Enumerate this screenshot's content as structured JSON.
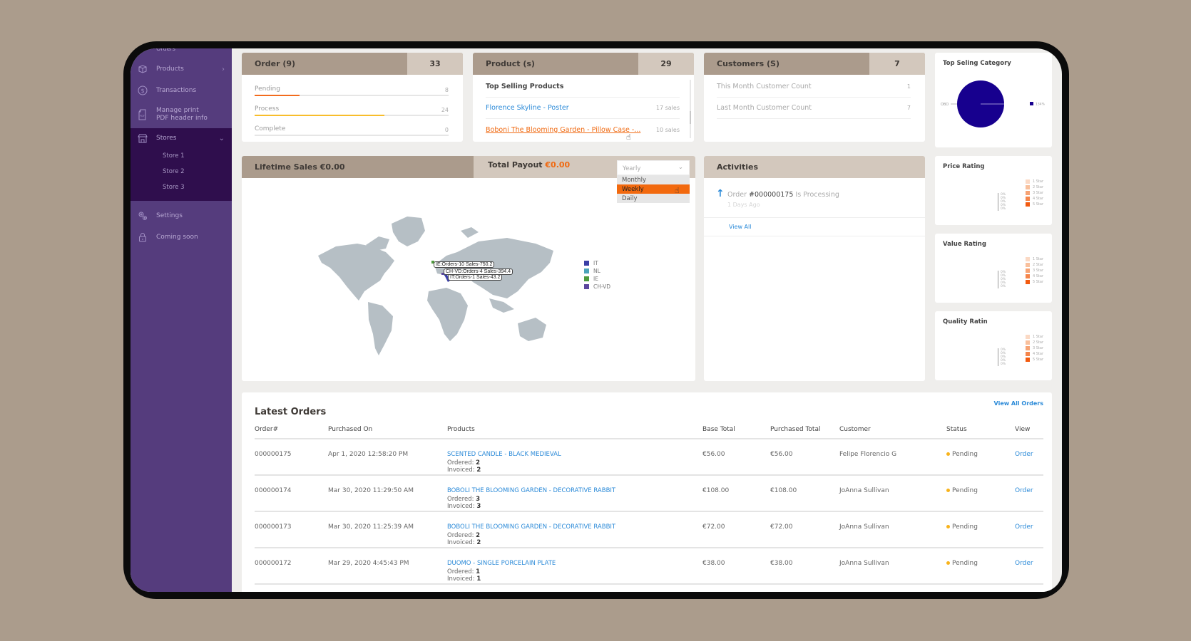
{
  "sidebar": {
    "top_partial": "Orders",
    "items": [
      {
        "label": "Products",
        "icon": "box-icon"
      },
      {
        "label": "Transactions",
        "icon": "dollar-circle-icon"
      },
      {
        "label": "Manage print PDF header info",
        "icon": "pdf-file-icon"
      },
      {
        "label": "Stores",
        "icon": "store-icon"
      },
      {
        "label": "Settings",
        "icon": "gears-icon"
      },
      {
        "label": "Coming soon",
        "icon": "lock-icon"
      }
    ],
    "stores": [
      "Store 1",
      "Store 2",
      "Store 3"
    ]
  },
  "orders_card": {
    "title": "Order (9)",
    "count": "33",
    "rows": [
      {
        "label": "Pending",
        "value": "8",
        "percent": 23,
        "color": "#f26b1d"
      },
      {
        "label": "Process",
        "value": "24",
        "percent": 67,
        "color": "#f8bd2c"
      },
      {
        "label": "Complete",
        "value": "0",
        "percent": 0,
        "color": "#f8bd2c"
      }
    ]
  },
  "products_card": {
    "title": "Product (s)",
    "count": "29",
    "subtitle": "Top Selling Products",
    "items": [
      {
        "name": "Florence Skyline  - Poster",
        "sales": "17 sales"
      },
      {
        "name": "Boboni The Blooming Garden - Pillow Case -...",
        "sales": "10 sales"
      }
    ]
  },
  "customers_card": {
    "title": "Customers (S)",
    "count": "7",
    "rows": [
      {
        "label": "This Month Customer Count",
        "value": "1"
      },
      {
        "label": "Last Month Customer Count",
        "value": "7"
      }
    ]
  },
  "top_category": {
    "title": "Top Seling Category",
    "slice_label": "OBO",
    "legend_value": "134%",
    "color": "#17008e"
  },
  "ratings": [
    {
      "title": "Price Rating"
    },
    {
      "title": "Value Rating"
    },
    {
      "title": "Quality Ratin"
    }
  ],
  "rating_legend": [
    {
      "label": "1 Star",
      "color": "#fbd9c4"
    },
    {
      "label": "2 Star",
      "color": "#f9c09c"
    },
    {
      "label": "3 Star",
      "color": "#f7a374"
    },
    {
      "label": "4 Star",
      "color": "#f5854a"
    },
    {
      "label": "5 Star",
      "color": "#f25a0f"
    }
  ],
  "rating_pct": [
    "0%",
    "0%",
    "0%",
    "0%",
    "0%"
  ],
  "sales_card": {
    "lifetime_label": "Lifetime Sales €0.00",
    "payout_label": "Total Payout",
    "payout_value": "€0.00",
    "period_select": "Yearly",
    "period_options": [
      "Monthly",
      "Weekly",
      "Daily"
    ],
    "highlighted_option": "Weekly"
  },
  "map": {
    "tooltips": [
      "IE:Orders-10 Sales-750.2",
      "CH-VD:Orders-4 Sales-394.4",
      "IT:Orders-1 Sales-43.2"
    ],
    "legend": [
      {
        "label": "IT",
        "color": "#3a3fa6"
      },
      {
        "label": "NL",
        "color": "#4ba3b9"
      },
      {
        "label": "IE",
        "color": "#4e9a3c"
      },
      {
        "label": "CH-VD",
        "color": "#5c479e"
      }
    ]
  },
  "activities": {
    "title": "Activities",
    "entry_prefix": "Order",
    "entry_order": "#000000175",
    "entry_suffix": "Is Processing",
    "entry_time": "1 Days Ago",
    "view_all": "View All"
  },
  "latest_orders": {
    "title": "Latest Orders",
    "view_all": "View All Orders",
    "columns": [
      "Order#",
      "Purchased On",
      "Products",
      "Base Total",
      "Purchased Total",
      "Customer",
      "Status",
      "View"
    ],
    "ordered_label": "Ordered:",
    "invoiced_label": "Invoiced:",
    "rows": [
      {
        "order": "000000175",
        "date": "Apr 1, 2020 12:58:20 PM",
        "product": "SCENTED CANDLE - BLACK MEDIEVAL",
        "ordered": "2",
        "invoiced": "2",
        "base": "€56.00",
        "purchased": "€56.00",
        "customer": "Felipe Florencio G",
        "status": "Pending",
        "view": "Order"
      },
      {
        "order": "000000174",
        "date": "Mar 30, 2020 11:29:50 AM",
        "product": "BOBOLI THE BLOOMING GARDEN - DECORATIVE RABBIT",
        "ordered": "3",
        "invoiced": "3",
        "base": "€108.00",
        "purchased": "€108.00",
        "customer": "JoAnna Sullivan",
        "status": "Pending",
        "view": "Order"
      },
      {
        "order": "000000173",
        "date": "Mar 30, 2020 11:25:39 AM",
        "product": "BOBOLI THE BLOOMING GARDEN - DECORATIVE RABBIT",
        "ordered": "2",
        "invoiced": "2",
        "base": "€72.00",
        "purchased": "€72.00",
        "customer": "JoAnna Sullivan",
        "status": "Pending",
        "view": "Order"
      },
      {
        "order": "000000172",
        "date": "Mar 29, 2020 4:45:43 PM",
        "product": "DUOMO - SINGLE PORCELAIN PLATE",
        "ordered": "1",
        "invoiced": "1",
        "base": "€38.00",
        "purchased": "€38.00",
        "customer": "JoAnna Sullivan",
        "status": "Pending",
        "view": "Order"
      }
    ]
  }
}
